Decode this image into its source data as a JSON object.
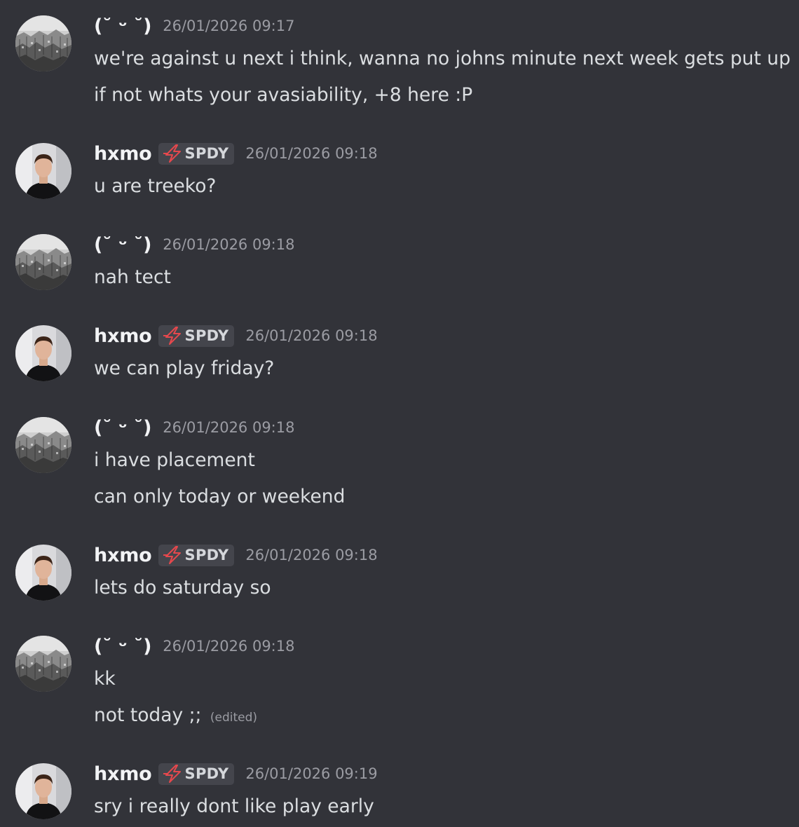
{
  "users": {
    "user1": {
      "name": "(˘ ᵕ ˘)"
    },
    "user2": {
      "name": "hxmo",
      "tag": "SPDY"
    }
  },
  "messages": [
    {
      "author": "(˘ ᵕ ˘)",
      "time": "26/01/2026 09:17",
      "lines": [
        "we're against u next i think, wanna no johns minute next week gets put up",
        "if not whats your avasiability, +8 here :P"
      ]
    },
    {
      "author": "hxmo",
      "tag": "SPDY",
      "time": "26/01/2026 09:18",
      "lines": [
        "u are treeko?"
      ]
    },
    {
      "author": "(˘ ᵕ ˘)",
      "time": "26/01/2026 09:18",
      "lines": [
        "nah tect"
      ]
    },
    {
      "author": "hxmo",
      "tag": "SPDY",
      "time": "26/01/2026 09:18",
      "lines": [
        "we can play friday?"
      ]
    },
    {
      "author": "(˘ ᵕ ˘)",
      "time": "26/01/2026 09:18",
      "lines": [
        "i have placement",
        "can only today or weekend"
      ]
    },
    {
      "author": "hxmo",
      "tag": "SPDY",
      "time": "26/01/2026 09:18",
      "lines": [
        "lets do saturday so"
      ]
    },
    {
      "author": "(˘ ᵕ ˘)",
      "time": "26/01/2026 09:18",
      "lines": [
        "kk",
        "not today ;;"
      ],
      "edited_label": "(edited)"
    },
    {
      "author": "hxmo",
      "tag": "SPDY",
      "time": "26/01/2026 09:19",
      "lines": [
        "sry i really dont like play early"
      ]
    }
  ],
  "colors": {
    "background": "#323339",
    "username": "#f2f3f5",
    "text": "#dbdee1",
    "muted": "#9b9ca3",
    "tag_bg": "#44454c",
    "tag_icon": "#e5484d"
  },
  "icons": {
    "tag_icon": "lightning-bolt-icon",
    "avatar_user1": "city-sketch-avatar",
    "avatar_user2": "person-photo-avatar"
  }
}
